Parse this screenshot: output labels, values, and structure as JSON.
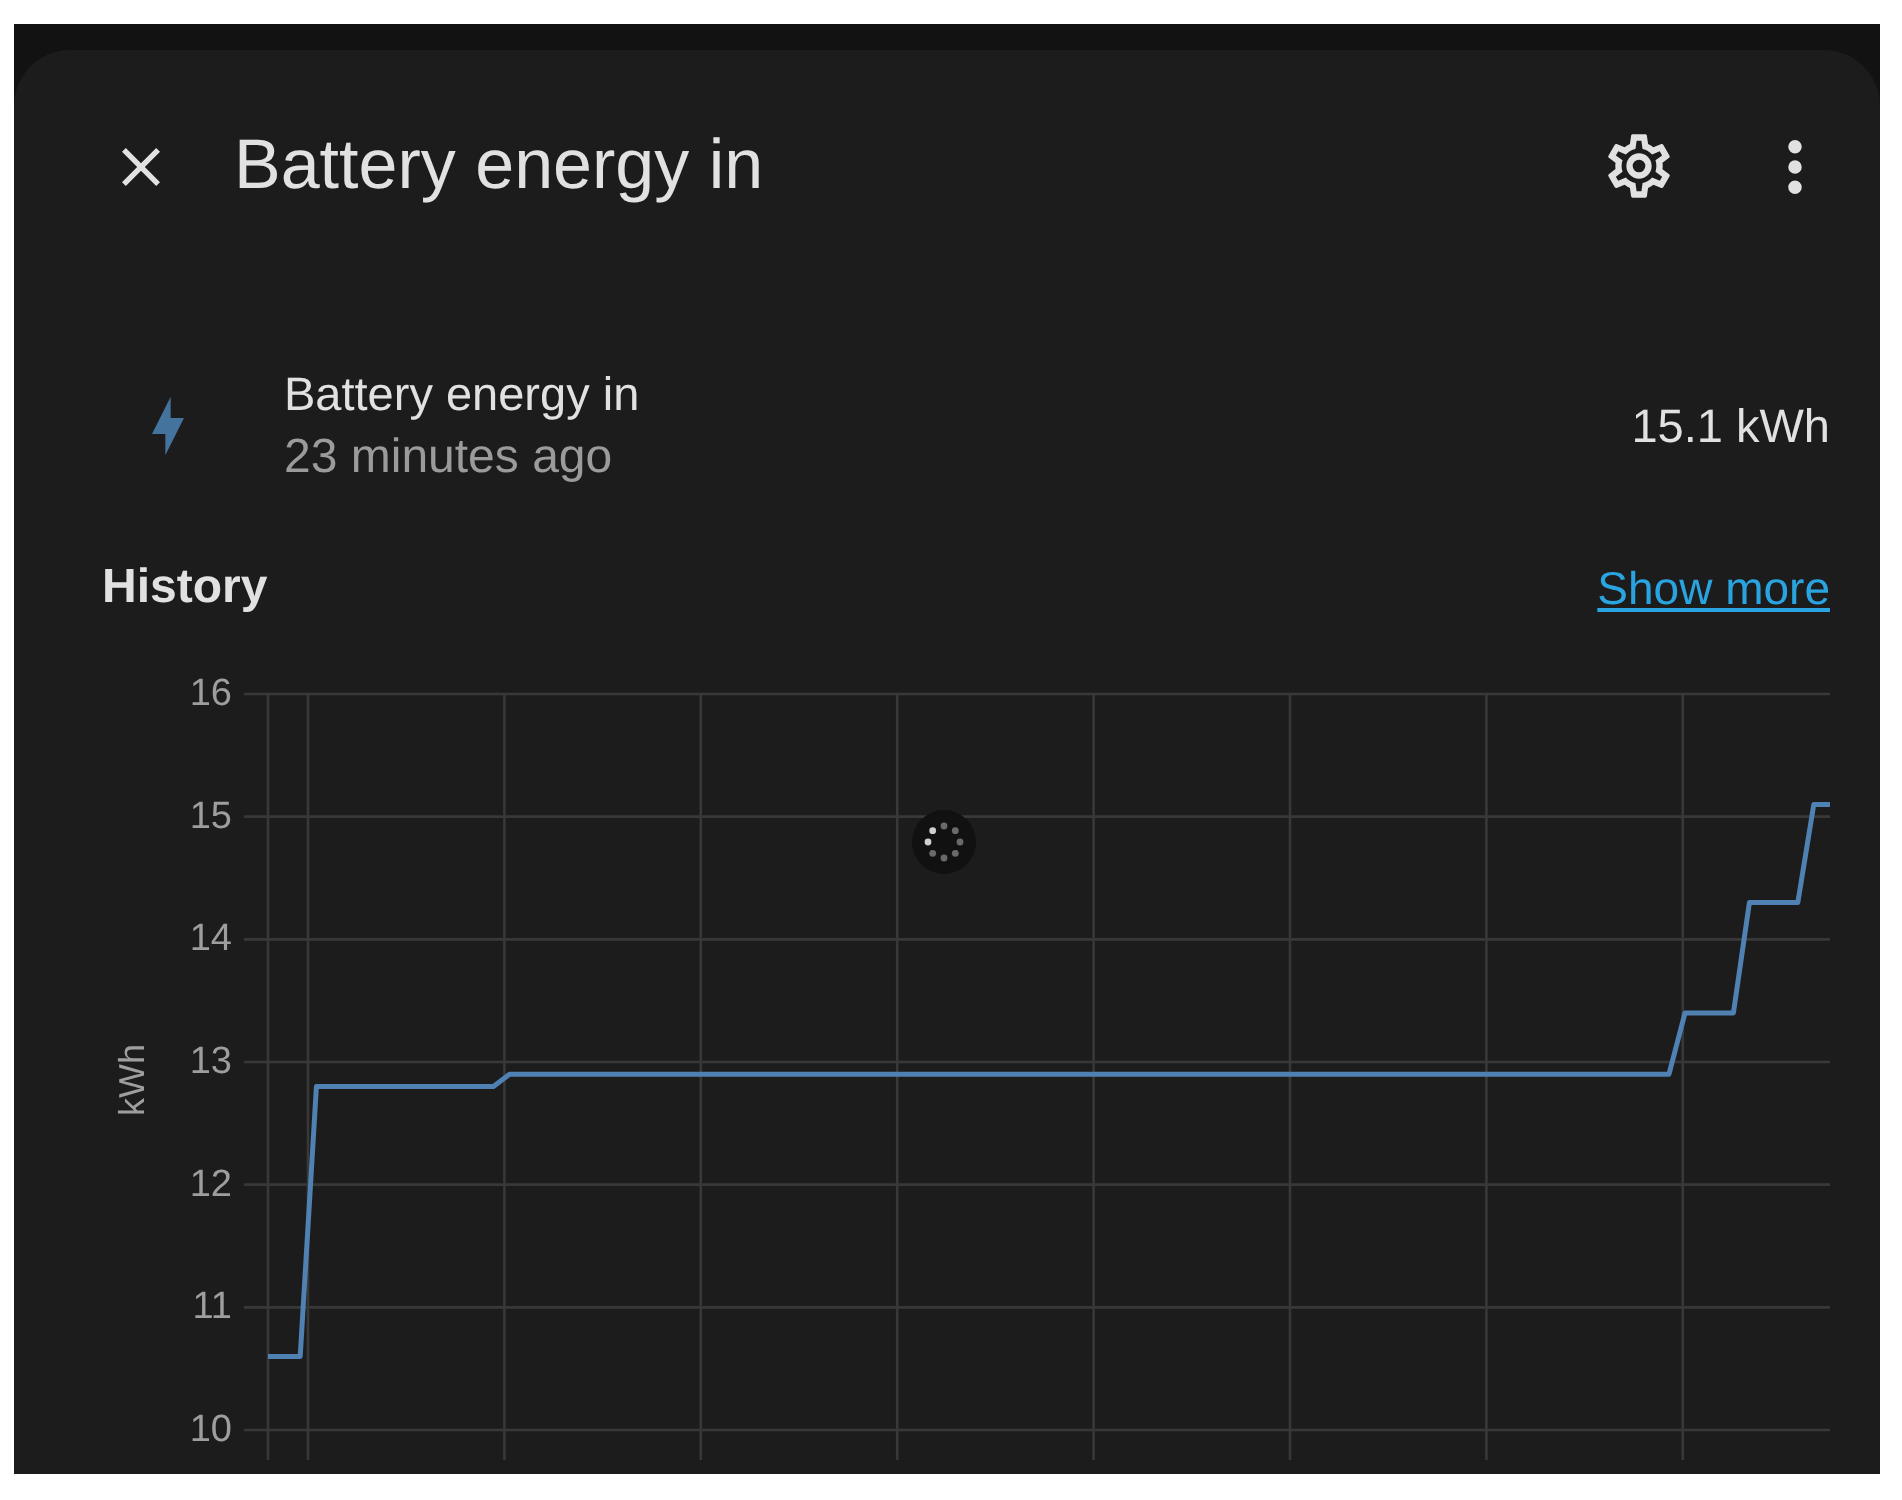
{
  "dialog": {
    "title": "Battery energy in"
  },
  "entity": {
    "name": "Battery energy in",
    "last_changed": "23 minutes ago",
    "state": "15.1 kWh"
  },
  "history": {
    "title": "History",
    "link": "Show more",
    "loading": true,
    "chart_data": {
      "type": "line",
      "ylabel": "kWh",
      "ylim": [
        10,
        16
      ],
      "yticks": [
        10,
        11,
        12,
        13,
        14,
        15,
        16
      ],
      "grid": true,
      "categories": [
        null,
        null,
        null,
        null,
        null,
        null,
        null,
        null,
        null,
        null,
        null,
        null,
        null,
        null,
        null,
        null,
        null,
        null,
        null,
        null,
        null,
        null,
        null,
        null,
        null,
        null,
        null,
        null,
        null,
        null,
        null,
        null,
        null,
        null,
        null,
        null,
        null,
        null,
        null,
        null,
        null,
        null,
        null,
        null,
        null,
        null,
        null,
        null,
        null,
        null,
        null,
        null,
        null,
        null,
        null,
        null,
        null,
        null,
        null,
        null,
        null,
        null,
        null,
        null,
        null,
        null,
        null,
        null,
        null,
        null,
        null,
        null,
        null,
        null,
        null,
        null,
        null,
        null,
        null,
        null,
        null,
        null,
        null,
        null,
        null,
        null,
        null,
        null,
        null,
        null,
        null,
        null,
        null,
        null,
        null,
        null,
        null,
        null
      ],
      "series": [
        {
          "color": "#4f81b3",
          "values": [
            10.6,
            10.6,
            10.6,
            12.8,
            12.8,
            12.8,
            12.8,
            12.8,
            12.8,
            12.8,
            12.8,
            12.8,
            12.8,
            12.8,
            12.8,
            12.9,
            12.9,
            12.9,
            12.9,
            12.9,
            12.9,
            12.9,
            12.9,
            12.9,
            12.9,
            12.9,
            12.9,
            12.9,
            12.9,
            12.9,
            12.9,
            12.9,
            12.9,
            12.9,
            12.9,
            12.9,
            12.9,
            12.9,
            12.9,
            12.9,
            12.9,
            12.9,
            12.9,
            12.9,
            12.9,
            12.9,
            12.9,
            12.9,
            12.9,
            12.9,
            12.9,
            12.9,
            12.9,
            12.9,
            12.9,
            12.9,
            12.9,
            12.9,
            12.9,
            12.9,
            12.9,
            12.9,
            12.9,
            12.9,
            12.9,
            12.9,
            12.9,
            12.9,
            12.9,
            12.9,
            12.9,
            12.9,
            12.9,
            12.9,
            12.9,
            12.9,
            12.9,
            12.9,
            12.9,
            12.9,
            12.9,
            12.9,
            12.9,
            12.9,
            12.9,
            12.9,
            12.9,
            12.9,
            13.4,
            13.4,
            13.4,
            13.4,
            14.3,
            14.3,
            14.3,
            14.3,
            15.1,
            15.1
          ]
        }
      ]
    }
  }
}
